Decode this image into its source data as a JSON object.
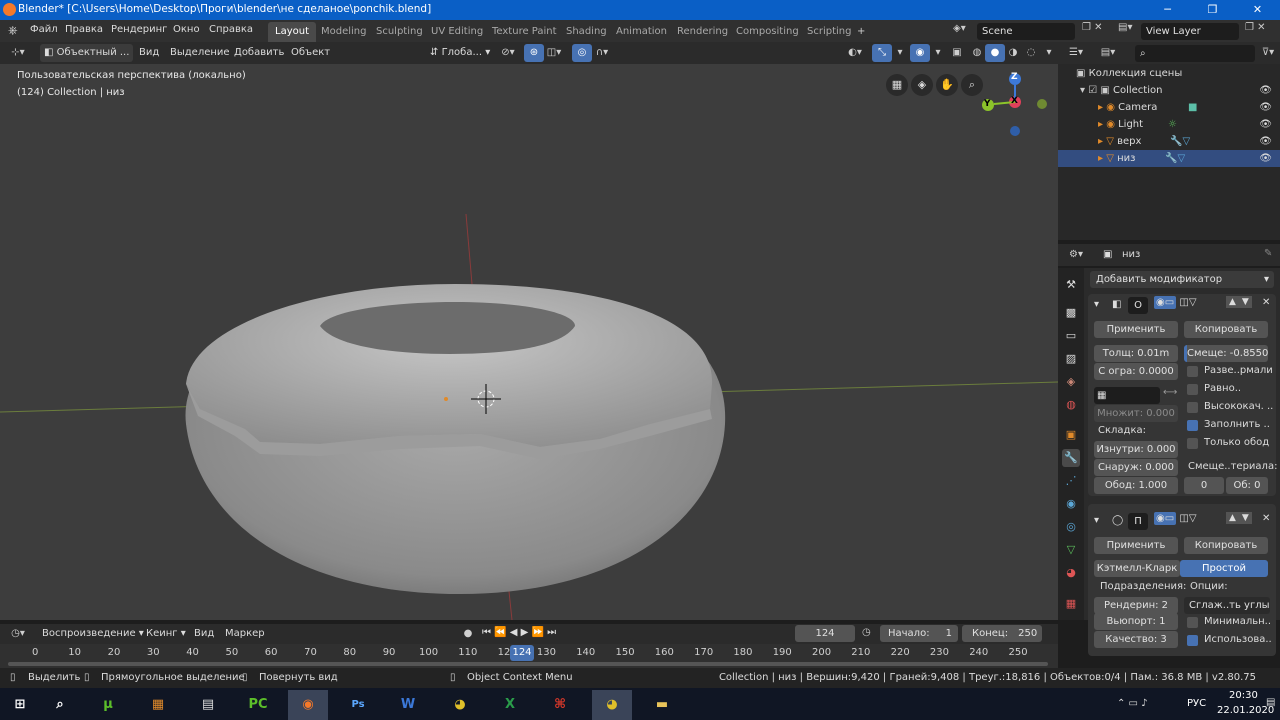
{
  "window": {
    "title": "Blender* [C:\\Users\\Home\\Desktop\\Проги\\blender\\не сделаное\\ponchik.blend]",
    "minimize": "─",
    "maximize": "❐",
    "close": "✕"
  },
  "menu": [
    "Файл",
    "Правка",
    "Рендеринг",
    "Окно",
    "Справка"
  ],
  "workspaces": [
    "Layout",
    "Modeling",
    "Sculpting",
    "UV Editing",
    "Texture Paint",
    "Shading",
    "Animation",
    "Rendering",
    "Compositing",
    "Scripting"
  ],
  "scene": "Scene",
  "view_layer": "View Layer",
  "viewport_header": {
    "mode": "Объектный ...",
    "view": "Вид",
    "select": "Выделение",
    "add": "Добавить",
    "object": "Объект",
    "transform": "Глоба..."
  },
  "viewport": {
    "perspective": "Пользовательская перспектива (локально)",
    "collection_info": "(124) Collection | низ",
    "gizmo": {
      "z": "Z",
      "y": "Y",
      "x": "X"
    }
  },
  "outliner": {
    "root": "Коллекция сцены",
    "items": [
      {
        "name": "Collection"
      },
      {
        "name": "Camera"
      },
      {
        "name": "Light"
      },
      {
        "name": "верх"
      },
      {
        "name": "низ"
      }
    ]
  },
  "properties": {
    "object_name": "низ",
    "add_modifier": "Добавить модификатор",
    "solidify": {
      "name": "О",
      "apply": "Применить",
      "copy": "Копировать",
      "thickness": "Толщ:  0.01m",
      "offset": "Смеще: -0.8550",
      "clamp": "С огра:  0.0000",
      "even": "Разве..рмали",
      "equal": "Равно..",
      "high_quality": "Высококач. ..",
      "fill": "Заполнить ..",
      "rim_only": "Только обод",
      "factor": "Множит:  0.000",
      "crease_label": "Складка:",
      "inner": "Изнутри:  0.000",
      "outer": "Снаруж:  0.000",
      "rim": "Обод:        1.000",
      "material_offset": "Смеще..териала:",
      "mat_a": "0",
      "mat_b": "Об:  0"
    },
    "subsurf": {
      "name": "П",
      "apply": "Применить",
      "copy": "Копировать",
      "catmull": "Кэтмелл-Кларк",
      "simple": "Простой",
      "subdivisions": "Подразделения:",
      "options": "Опции:",
      "render": "Рендерин:  2",
      "viewport": "Вьюпорт:  1",
      "quality": "Качество:  3",
      "smooth": "Сглаж..ть углы",
      "minimal": "Минимальн..",
      "use": "Использова.."
    }
  },
  "timeline": {
    "playback": "Воспроизведение",
    "keying": "Кеинг",
    "view": "Вид",
    "markers": "Маркер",
    "frame": "124",
    "start_label": "Начало:",
    "start": "1",
    "end_label": "Конец:",
    "end": "250",
    "current": "124",
    "ticks": [
      "0",
      "10",
      "20",
      "30",
      "40",
      "50",
      "60",
      "70",
      "80",
      "90",
      "100",
      "110",
      "120",
      "130",
      "140",
      "150",
      "160",
      "170",
      "180",
      "190",
      "200",
      "210",
      "220",
      "230",
      "240",
      "250"
    ]
  },
  "status": {
    "select": "Выделить",
    "box": "Прямоугольное выделение",
    "rotate": "Повернуть вид",
    "context": "Object Context Menu",
    "info": "Collection | низ | Вершин:9,420 | Граней:9,408 | Треуг.:18,816 | Объектов:0/4 | Пам.: 36.8 MB | v2.80.75"
  },
  "taskbar": {
    "time": "20:30",
    "date": "22.01.2020",
    "lang": "РУС"
  }
}
